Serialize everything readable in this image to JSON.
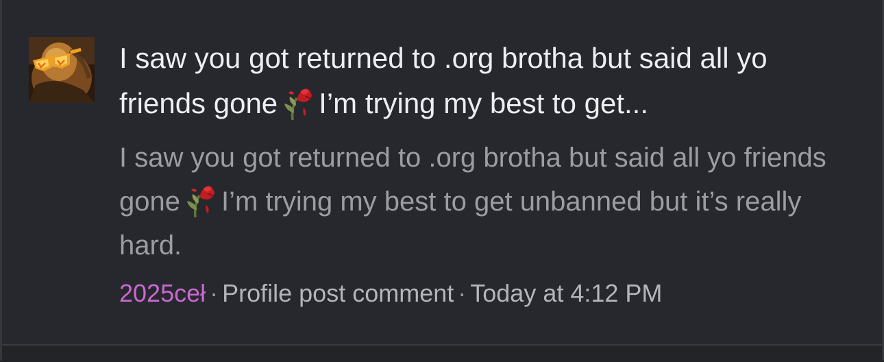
{
  "post": {
    "title_before_emoji": "I saw you got returned to .org brotha but said all yo friends gone",
    "title_after_emoji": "I’m trying my best to get...",
    "snippet_before_emoji": "I saw you got returned to .org brotha but said all yo friends gone",
    "snippet_after_emoji": "I’m trying my best to get unbanned but it’s really hard.",
    "emoji_icon": "wilted-rose-icon"
  },
  "meta": {
    "username": "2025ceł",
    "separator": "·",
    "type_label": "Profile post comment",
    "timestamp": "Today at 4:12 PM"
  },
  "colors": {
    "background": "#27282d",
    "title": "#eceef2",
    "snippet": "#9b9da3",
    "username": "#c869d3"
  }
}
